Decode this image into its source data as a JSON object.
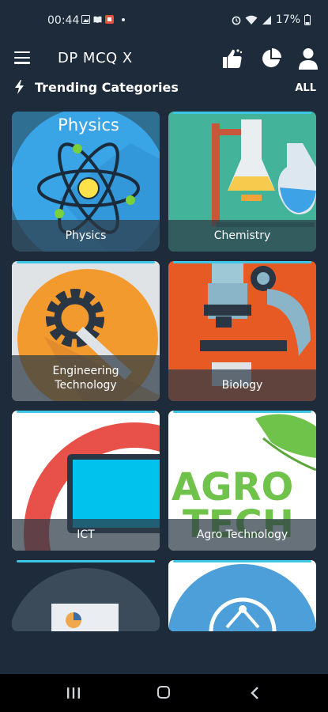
{
  "status_bar": {
    "time": "00:44",
    "battery": "17%"
  },
  "header": {
    "title": "DP MCQ X"
  },
  "trending": {
    "title": "Trending Categories",
    "all_label": "ALL"
  },
  "categories": [
    {
      "label": "Physics",
      "art_title": "Physics",
      "icon": "atom-icon"
    },
    {
      "label": "Chemistry",
      "icon": "flask-icon"
    },
    {
      "label": "Engineering\nTechnology",
      "icon": "gear-wrench-icon"
    },
    {
      "label": "Biology",
      "icon": "microscope-icon"
    },
    {
      "label": "ICT",
      "icon": "monitor-icon"
    },
    {
      "label": "Agro Technology",
      "art_title_1": "AGRO",
      "art_title_2": "TECH",
      "icon": "leaf-icon"
    },
    {
      "label": "",
      "icon": "chart-screen-icon"
    },
    {
      "label": "",
      "icon": "network-icon"
    }
  ],
  "colors": {
    "background": "#1d2b3a",
    "accent": "#3ec6e6",
    "navbar": "#000000"
  }
}
